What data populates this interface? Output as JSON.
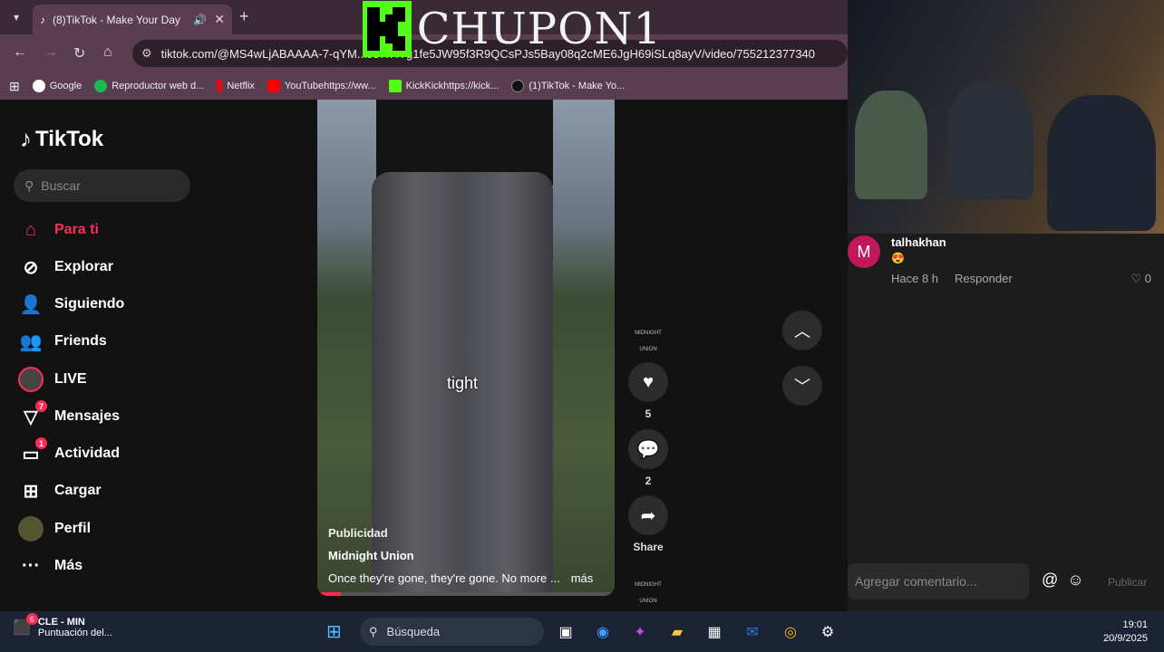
{
  "browser": {
    "tab_title": "(8)TikTok - Make Your Day",
    "url": "tiktok.com/@MS4wLjABAAAA-7-qYM...Jo7h4Tg1fe5JW95f3R9QCsPJs5Bay08q2cME6JgH69iSLq8ayV/video/755212377340",
    "bookmarks": [
      "Google",
      "Reproductor web d...",
      "Netflix",
      "YouTubehttps://ww...",
      "KickKickhttps://kick...",
      "(1)TikTok - Make Yo..."
    ]
  },
  "overlay_logo": "CHUPON1",
  "sidebar": {
    "brand": "TikTok",
    "search_placeholder": "Buscar",
    "items": [
      {
        "label": "Para ti",
        "icon": "home-icon"
      },
      {
        "label": "Explorar",
        "icon": "compass-icon"
      },
      {
        "label": "Siguiendo",
        "icon": "following-icon"
      },
      {
        "label": "Friends",
        "icon": "friends-icon"
      },
      {
        "label": "LIVE",
        "icon": "live-icon"
      },
      {
        "label": "Mensajes",
        "icon": "messages-icon",
        "badge": "7"
      },
      {
        "label": "Actividad",
        "icon": "activity-icon",
        "badge": "1"
      },
      {
        "label": "Cargar",
        "icon": "upload-icon"
      },
      {
        "label": "Perfil",
        "icon": "profile-icon"
      },
      {
        "label": "Más",
        "icon": "more-icon"
      }
    ]
  },
  "video": {
    "overlay_text": "tight",
    "badge": "Publicidad",
    "author": "Midnight Union",
    "caption": "Once they're gone, they're gone. No more ...",
    "more": "más",
    "progress": 0.08,
    "likes": "5",
    "comments": "2",
    "share": "Share",
    "brand_tag": "MIDNIGHT UNION"
  },
  "comment": {
    "avatar_letter": "M",
    "user": "talhakhan",
    "emoji": "😍",
    "time": "Hace 8 h",
    "reply": "Responder",
    "likes": "0"
  },
  "composer": {
    "placeholder": "Agregar comentario...",
    "publish": "Publicar"
  },
  "taskbar": {
    "badge": "6",
    "weather_title": "CLE - MIN",
    "weather_sub": "Puntuación del...",
    "search": "Búsqueda",
    "time": "19:01",
    "date": "20/9/2025"
  }
}
